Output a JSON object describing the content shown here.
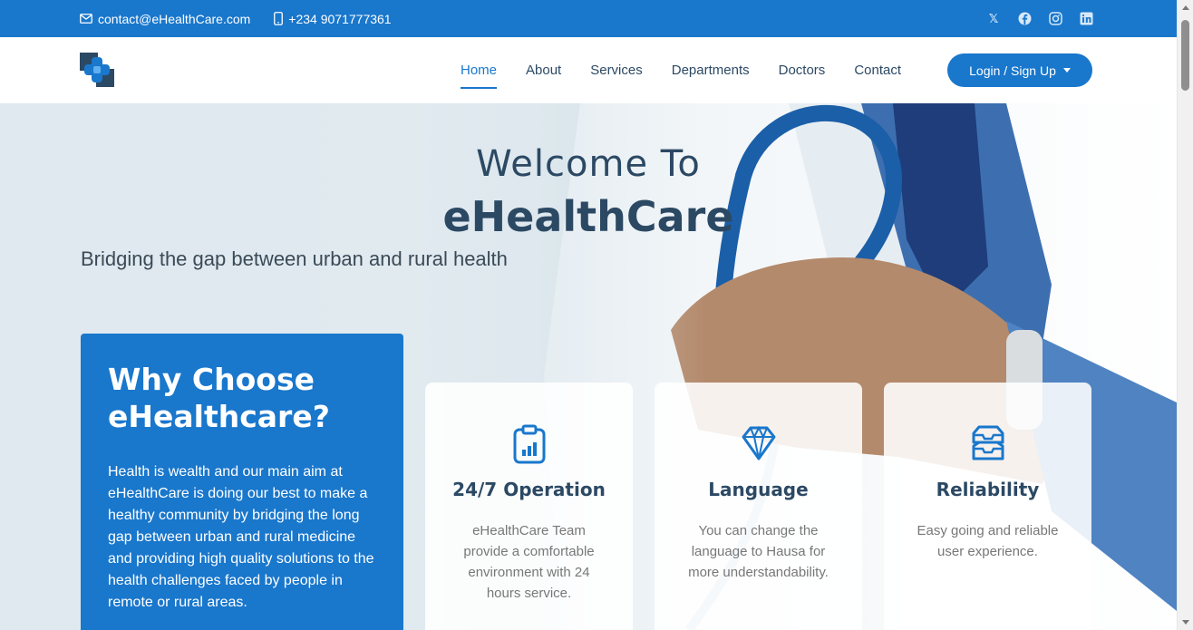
{
  "topbar": {
    "email": "contact@eHealthCare.com",
    "phone": "+234 9071777361",
    "social": [
      {
        "icon": "x-twitter-icon",
        "glyph": "𝕏"
      },
      {
        "icon": "facebook-icon",
        "glyph": "f"
      },
      {
        "icon": "instagram-icon",
        "glyph": "◎"
      },
      {
        "icon": "linkedin-icon",
        "glyph": "in"
      }
    ]
  },
  "nav": {
    "links": [
      "Home",
      "About",
      "Services",
      "Departments",
      "Doctors",
      "Contact"
    ],
    "active": "Home",
    "login_label": "Login / Sign Up"
  },
  "hero": {
    "welcome": "Welcome To",
    "brand": "eHealthCare",
    "tagline": "Bridging the gap between urban and rural health"
  },
  "why": {
    "title": "Why Choose eHealthcare?",
    "text": "Health is wealth and our main aim at eHealthCare is doing our best to make a healthy community by bridging the long gap between urban and rural medicine and providing high quality solutions to the health challenges faced by people in remote or rural areas."
  },
  "cards": [
    {
      "icon": "clipboard-chart-icon",
      "title": "24/7 Operation",
      "text": "eHealthCare Team provide a comfortable environment with 24 hours service."
    },
    {
      "icon": "gem-icon",
      "title": "Language",
      "text": "You can change the language to Hausa for more understandability."
    },
    {
      "icon": "inboxes-icon",
      "title": "Reliability",
      "text": "Easy going and reliable user experience."
    }
  ],
  "colors": {
    "primary": "#1977cc",
    "heading": "#2c4964",
    "muted": "#777777"
  }
}
